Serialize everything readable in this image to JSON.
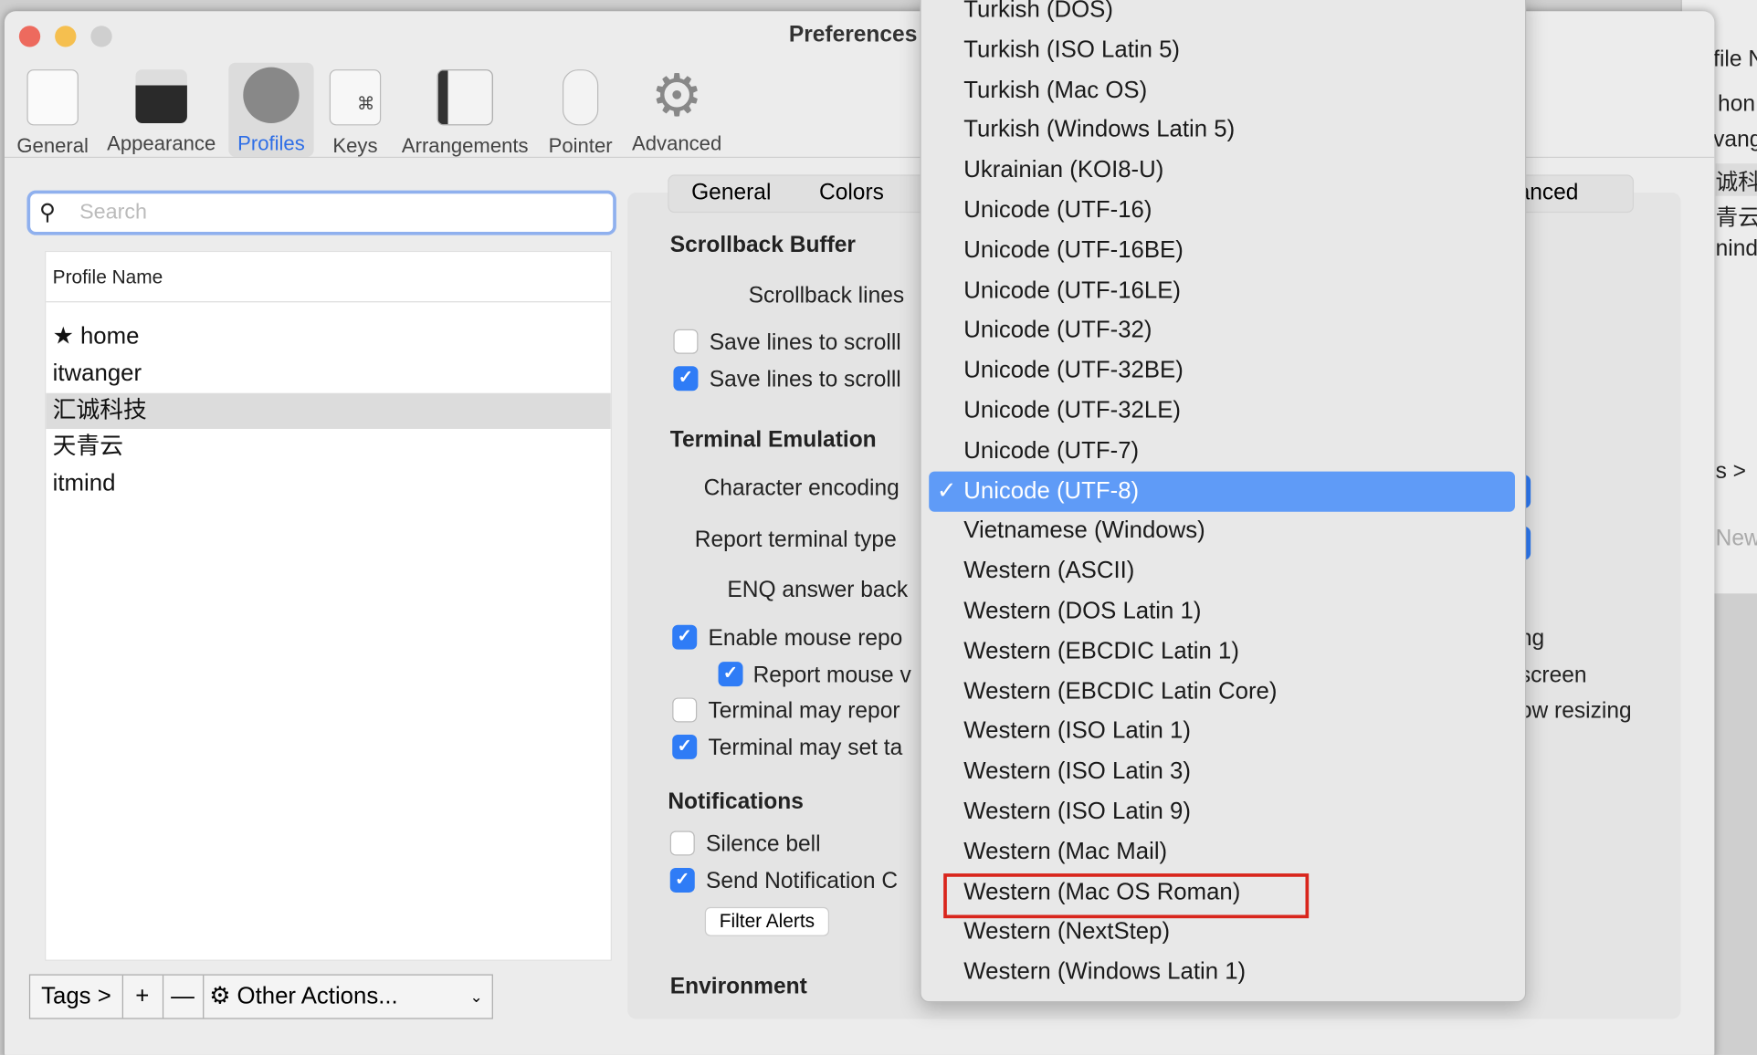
{
  "window": {
    "title": "Preferences"
  },
  "toolbar": [
    {
      "label": "General",
      "icon": "toggle-switch-icon"
    },
    {
      "label": "Appearance",
      "icon": "terminal-window-icon"
    },
    {
      "label": "Profiles",
      "icon": "user-silhouette-icon",
      "selected": true
    },
    {
      "label": "Keys",
      "icon": "command-key-icon"
    },
    {
      "label": "Arrangements",
      "icon": "windows-stack-icon"
    },
    {
      "label": "Pointer",
      "icon": "mouse-icon"
    },
    {
      "label": "Advanced",
      "icon": "gear-icon"
    }
  ],
  "search": {
    "placeholder": "Search",
    "value": ""
  },
  "profiles": {
    "header": "Profile Name",
    "rows": [
      "home",
      "itwanger",
      "汇诚科技",
      "天青云",
      "itmind"
    ],
    "default_star": "★",
    "selected": "汇诚科技"
  },
  "bottom_bar": {
    "tags": "Tags >",
    "add": "+",
    "remove": "—",
    "other_actions": "Other Actions..."
  },
  "tabs": {
    "general": "General",
    "colors": "Colors",
    "advanced_partial": "dvanced"
  },
  "settings": {
    "scrollback_heading": "Scrollback Buffer",
    "scrollback_lines": "Scrollback lines",
    "save_lines_1": "Save lines to scrolll",
    "save_lines_2": "Save lines to scrolll",
    "terminal_heading": "Terminal Emulation",
    "char_encoding": "Character encoding",
    "report_type": "Report terminal type",
    "enq": "ENQ answer back",
    "enable_mouse": "Enable mouse repo",
    "report_mouse": "Report mouse v",
    "terminal_may_report": "Terminal may repor",
    "terminal_may_set": "Terminal may set ta",
    "right_ng": "ng",
    "right_screen": "screen",
    "right_resizing": "ow resizing",
    "notifications_heading": "Notifications",
    "silence_bell": "Silence bell",
    "send_notification": "Send Notification C",
    "filter_alerts": "Filter Alerts",
    "environment_heading": "Environment"
  },
  "checkboxes": {
    "save_lines_1": false,
    "save_lines_2": true,
    "enable_mouse": true,
    "report_mouse": true,
    "terminal_may_report": false,
    "terminal_may_set": true,
    "silence_bell": false,
    "send_notification": true
  },
  "encoding_menu": {
    "items": [
      "Turkish (DOS)",
      "Turkish (ISO Latin 5)",
      "Turkish (Mac OS)",
      "Turkish (Windows Latin 5)",
      "Ukrainian (KOI8-U)",
      "Unicode (UTF-16)",
      "Unicode (UTF-16BE)",
      "Unicode (UTF-16LE)",
      "Unicode (UTF-32)",
      "Unicode (UTF-32BE)",
      "Unicode (UTF-32LE)",
      "Unicode (UTF-7)",
      "Unicode (UTF-8)",
      "Vietnamese (Windows)",
      "Western (ASCII)",
      "Western (DOS Latin 1)",
      "Western (EBCDIC Latin 1)",
      "Western (EBCDIC Latin Core)",
      "Western (ISO Latin 1)",
      "Western (ISO Latin 3)",
      "Western (ISO Latin 9)",
      "Western (Mac Mail)",
      "Western (Mac OS Roman)",
      "Western (NextStep)",
      "Western (Windows Latin 1)"
    ],
    "selected": "Unicode (UTF-8)",
    "checkmark": "✓",
    "highlighted_annotation": "Western (Mac OS Roman)"
  },
  "background_window": {
    "texts": [
      "file N",
      "hon",
      "vang",
      "诚科",
      "青云",
      "nind",
      "s >",
      "New"
    ]
  },
  "colors": {
    "accent": "#2f7cf6",
    "menu_selection": "#5f9bf7",
    "annotation_red": "#d9251c"
  }
}
